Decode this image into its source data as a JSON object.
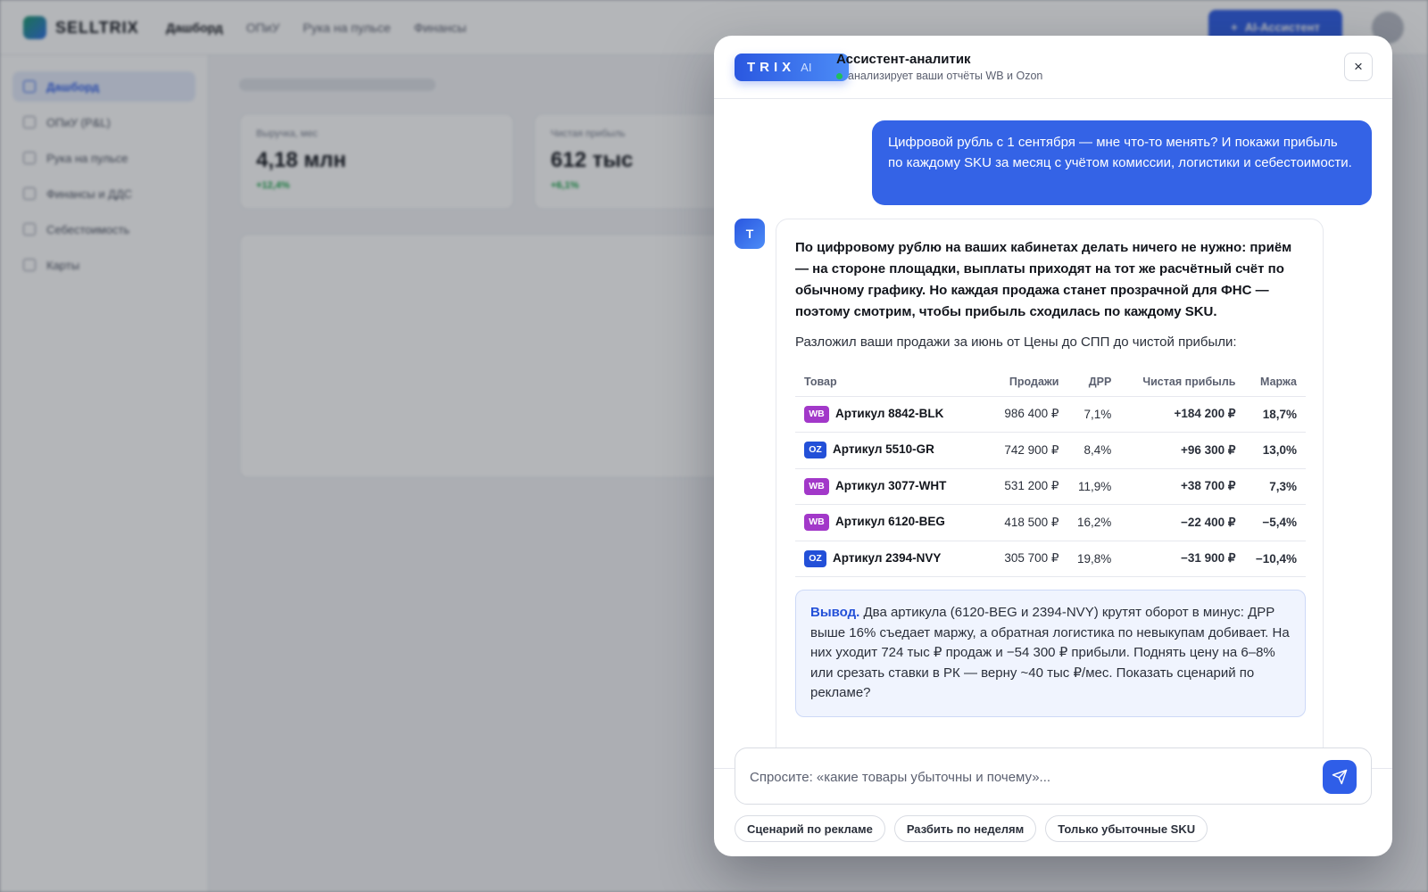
{
  "app": {
    "logo_text": "SELLTRIX",
    "nav": [
      "Дашборд",
      "ОПиУ",
      "Рука на пульсе",
      "Финансы"
    ],
    "ai_button_label": "AI-Ассистент",
    "sidebar": [
      "Дашборд",
      "ОПиУ (P&L)",
      "Рука на пульсе",
      "Финансы и ДДС",
      "Себестоимость",
      "Карты"
    ],
    "kpis": [
      {
        "label": "Выручка, мес",
        "value": "4,18 млн",
        "delta": "+12,4%"
      },
      {
        "label": "Чистая прибыль",
        "value": "612 тыс",
        "delta": "+6,1%"
      }
    ]
  },
  "assistant": {
    "logo_word": "TRIX",
    "logo_ai": "AI",
    "title": "Ассистент-аналитик",
    "subtitle": "анализирует ваши отчёты WB и Ozon",
    "close_label": "×",
    "user_message": "Цифровой рубль с 1 сентября — мне что-то менять? И покажи прибыль по каждому SKU за месяц с учётом комиссии, логистики и себестоимости.",
    "bot_avatar_letter": "T",
    "bot_lead": "По цифровому рублю на ваших кабинетах делать ничего не нужно: приём — на стороне площадки, выплаты приходят на тот же расчётный счёт по обычному графику. Но каждая продажа станет прозрачной для ФНС — поэтому смотрим, чтобы прибыль сходилась по каждому SKU.",
    "bot_intro": "Разложил ваши продажи за июнь от Цены до СПП до чистой прибыли:",
    "table": {
      "headers": [
        "Товар",
        "Продажи",
        "ДРР",
        "Чистая прибыль",
        "Маржа"
      ],
      "rows": [
        {
          "mp": "WB",
          "name": "Артикул 8842-BLK",
          "sales": "986 400 ₽",
          "drr": "7,1%",
          "profit": "+184 200 ₽",
          "margin": "18,7%"
        },
        {
          "mp": "OZ",
          "name": "Артикул 5510-GR",
          "sales": "742 900 ₽",
          "drr": "8,4%",
          "profit": "+96 300 ₽",
          "margin": "13,0%"
        },
        {
          "mp": "WB",
          "name": "Артикул 3077-WHT",
          "sales": "531 200 ₽",
          "drr": "11,9%",
          "profit": "+38 700 ₽",
          "margin": "7,3%"
        },
        {
          "mp": "WB",
          "name": "Артикул 6120-BEG",
          "sales": "418 500 ₽",
          "drr": "16,2%",
          "profit": "−22 400 ₽",
          "margin": "−5,4%"
        },
        {
          "mp": "OZ",
          "name": "Артикул 2394-NVY",
          "sales": "305 700 ₽",
          "drr": "19,8%",
          "profit": "−31 900 ₽",
          "margin": "−10,4%"
        }
      ]
    },
    "conclusion_label": "Вывод.",
    "conclusion_text": "Два артикула (6120-BEG и 2394-NVY) крутят оборот в минус: ДРР выше 16% съедает маржу, а обратная логистика по невыкупам добивает. На них уходит 724 тыс ₽ продаж и −54 300 ₽ прибыли. Поднять цену на 6–8% или срезать ставки в РК — верну ~40 тыс ₽/мес. Показать сценарий по рекламе?",
    "composer_placeholder": "Спросите: «какие товары убыточны и почему»...",
    "suggestions": [
      "Сценарий по рекламе",
      "Разбить по неделям",
      "Только убыточные SKU"
    ]
  },
  "colors": {
    "accent": "#2f5ee8",
    "positive": "#1aa34a",
    "negative": "#e03131",
    "wb_badge": "#a238c9",
    "oz_badge": "#2350d8"
  },
  "icons": {
    "send": "send-icon",
    "close": "close-icon",
    "status": "status-dot"
  }
}
